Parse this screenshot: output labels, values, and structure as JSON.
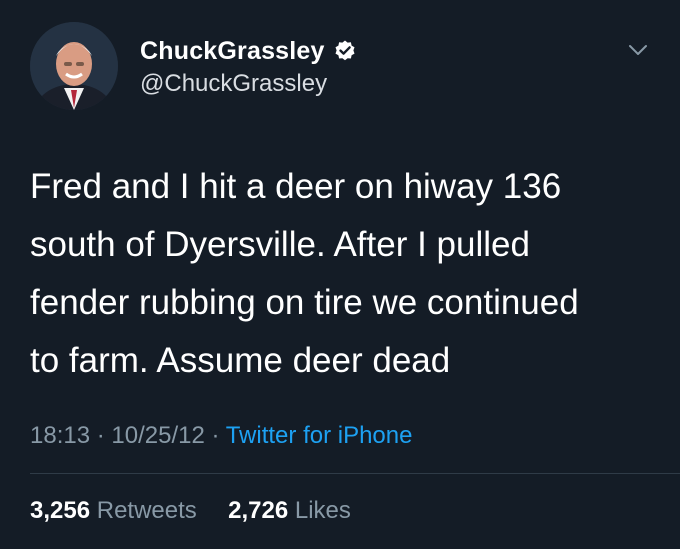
{
  "author": {
    "display_name": "ChuckGrassley",
    "handle": "@ChuckGrassley",
    "verified_icon": "verified-badge-icon",
    "menu_icon": "chevron-down-icon"
  },
  "tweet": {
    "lines": [
      "Fred and I hit a deer on hiway 136",
      "south of Dyersville. After I pulled",
      "fender rubbing on tire we continued",
      "to farm. Assume deer dead"
    ]
  },
  "meta": {
    "time": "18:13",
    "separator1": " · ",
    "date": "10/25/12",
    "separator2": " · ",
    "source": "Twitter for iPhone"
  },
  "stats": {
    "retweets_count": "3,256",
    "retweets_label": "Retweets",
    "likes_count": "2,726",
    "likes_label": "Likes"
  },
  "colors": {
    "background": "#141c26",
    "text": "#ffffff",
    "secondary": "#8899a6",
    "link": "#1da1f2",
    "verified": "#ffffff"
  }
}
